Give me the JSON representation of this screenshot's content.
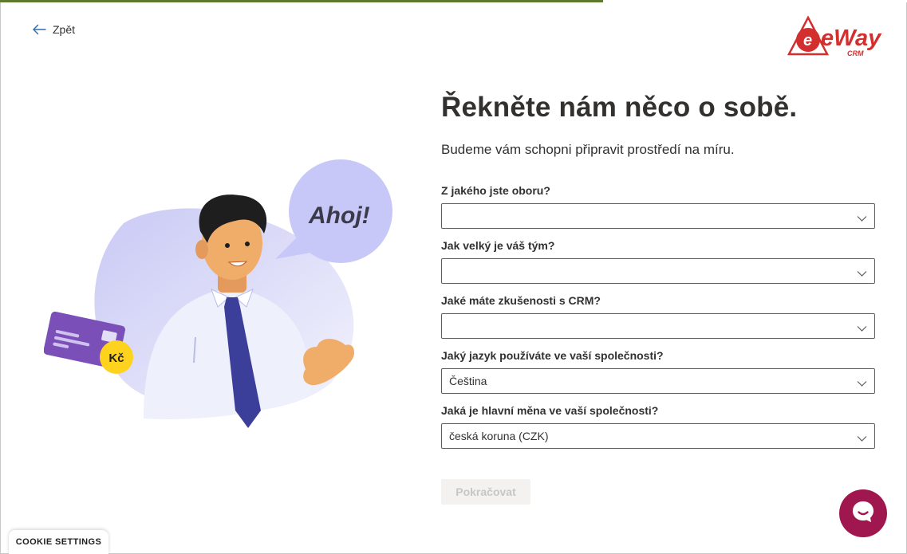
{
  "progress": {
    "fraction": 0.665,
    "color": "#5d7a2e"
  },
  "nav": {
    "back_label": "Zpět"
  },
  "logo": {
    "text": "eWay",
    "sub": "CRM",
    "color": "#d32f2f"
  },
  "illustration": {
    "speech_text": "Ahoj!",
    "badge_text": "Kč"
  },
  "page": {
    "title": "Řekněte nám něco o sobě.",
    "subtitle": "Budeme vám schopni připravit prostředí na míru."
  },
  "form": {
    "fields": [
      {
        "label": "Z jakého jste oboru?",
        "value": ""
      },
      {
        "label": "Jak velký je váš tým?",
        "value": ""
      },
      {
        "label": "Jaké máte zkušenosti s CRM?",
        "value": ""
      },
      {
        "label": "Jaký jazyk používáte ve vaší společnosti?",
        "value": "Čeština"
      },
      {
        "label": "Jaká je hlavní měna ve vaší společnosti?",
        "value": "česká koruna (CZK)"
      }
    ],
    "submit_label": "Pokračovat",
    "submit_disabled": true
  },
  "chat": {
    "icon": "chat-bubble-icon",
    "color": "#a0174f"
  },
  "cookie": {
    "label": "COOKIE SETTINGS"
  }
}
